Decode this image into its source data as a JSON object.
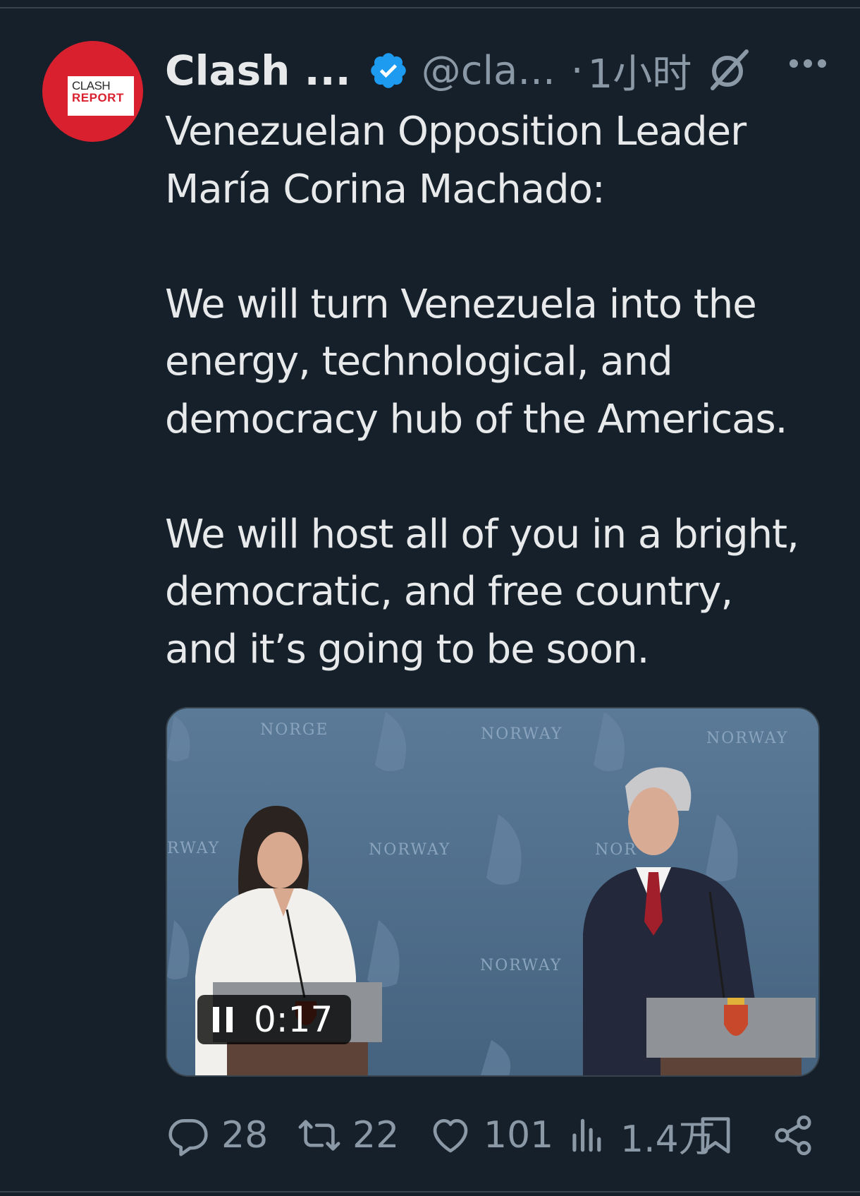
{
  "tweet": {
    "display_name": "Clash ...",
    "handle": "@cla...",
    "dot": "·",
    "time": "1小时",
    "avatar": {
      "line1": "CLASH",
      "line2": "REPORT"
    },
    "text": "Venezuelan Opposition Leader\nMaría Corina Machado:\n\nWe will turn Venezuela into the\nenergy, technological, and\ndemocracy hub of the Americas.\n\nWe will host all of you in a bright,\ndemocratic, and free country,\nand it’s going to be soon.",
    "icons": [
      "verified-badge-icon",
      "grok-icon",
      "more-icon"
    ]
  },
  "media": {
    "timer": "0:17",
    "watermarks": [
      "NORGE",
      "NORWAY",
      "NORWAY",
      "RWAY",
      "NORWAY",
      "NOR",
      "NORWAY"
    ]
  },
  "actions": {
    "replies": "28",
    "reposts": "22",
    "likes": "101",
    "views": "1.4万"
  },
  "colors": {
    "background": "#15202b",
    "text": "#e7e9ea",
    "muted": "#8b98a5",
    "verified": "#1d9bf0",
    "avatar_red": "#d9202e"
  }
}
